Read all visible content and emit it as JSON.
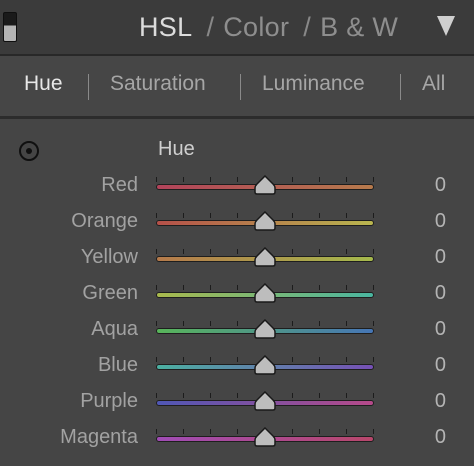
{
  "header": {
    "title_active": "HSL",
    "separator": "/",
    "title_color": "Color",
    "title_bw": "B & W"
  },
  "tabs": [
    {
      "label": "Hue",
      "active": true
    },
    {
      "label": "Saturation",
      "active": false
    },
    {
      "label": "Luminance",
      "active": false
    },
    {
      "label": "All",
      "active": false
    }
  ],
  "section": {
    "label": "Hue"
  },
  "sliders": [
    {
      "label": "Red",
      "value": "0",
      "colors": [
        "#b2435a",
        "#b67a4c"
      ]
    },
    {
      "label": "Orange",
      "value": "0",
      "colors": [
        "#b55049",
        "#b9b64f"
      ]
    },
    {
      "label": "Yellow",
      "value": "0",
      "colors": [
        "#b57a4b",
        "#a5b94c"
      ]
    },
    {
      "label": "Green",
      "value": "0",
      "colors": [
        "#a9b94d",
        "#4ab6a0"
      ]
    },
    {
      "label": "Aqua",
      "value": "0",
      "colors": [
        "#58b55a",
        "#4676b6"
      ]
    },
    {
      "label": "Blue",
      "value": "0",
      "colors": [
        "#4bb0a1",
        "#7650b5"
      ]
    },
    {
      "label": "Purple",
      "value": "0",
      "colors": [
        "#4f57b5",
        "#b64a8a"
      ]
    },
    {
      "label": "Magenta",
      "value": "0",
      "colors": [
        "#a04cb5",
        "#b8476b"
      ]
    }
  ],
  "slider_range": {
    "min": -100,
    "max": 100
  }
}
